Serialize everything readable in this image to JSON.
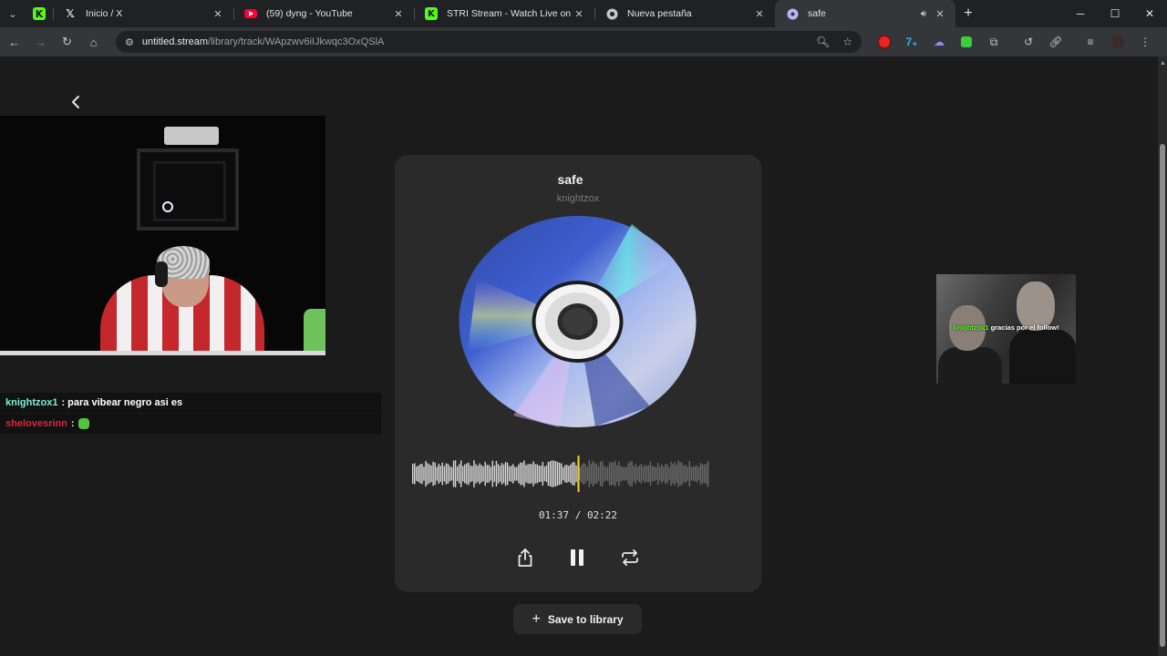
{
  "browser": {
    "tabs": [
      {
        "title": "Inicio / X",
        "favicon": "x-logo"
      },
      {
        "title": "(59) dyng - YouTube",
        "favicon": "youtube-logo"
      },
      {
        "title": "STRI Stream - Watch Live on Ki",
        "favicon": "kick-logo"
      },
      {
        "title": "Nueva pestaña",
        "favicon": "chrome-logo"
      },
      {
        "title": "safe",
        "favicon": "untitled-logo",
        "active": true
      }
    ],
    "address": {
      "host": "untitled.stream",
      "path": "/library/track/WApzwv6iIJkwqc3OxQSlA"
    },
    "colors": {
      "kick_green": "#53fc18",
      "youtube_red": "#ff0033"
    }
  },
  "overlay": {
    "chat": [
      {
        "user": "knightzox1",
        "user_color": "#7df0d6",
        "message": ": para vibear negro asi es"
      },
      {
        "user": "shelovesrinn",
        "user_color": "#e0243c",
        "message": ":",
        "emote": "green-emote"
      }
    ],
    "follow_alert": {
      "user": "knightzox1",
      "message": "gracias por el follow!"
    }
  },
  "player": {
    "title": "safe",
    "artist": "knightzox",
    "current_time": "01:37",
    "separator": "/",
    "duration": "02:22",
    "progress": 0.56,
    "accent_color": "#f0d21c",
    "save_label": "Save to library"
  }
}
